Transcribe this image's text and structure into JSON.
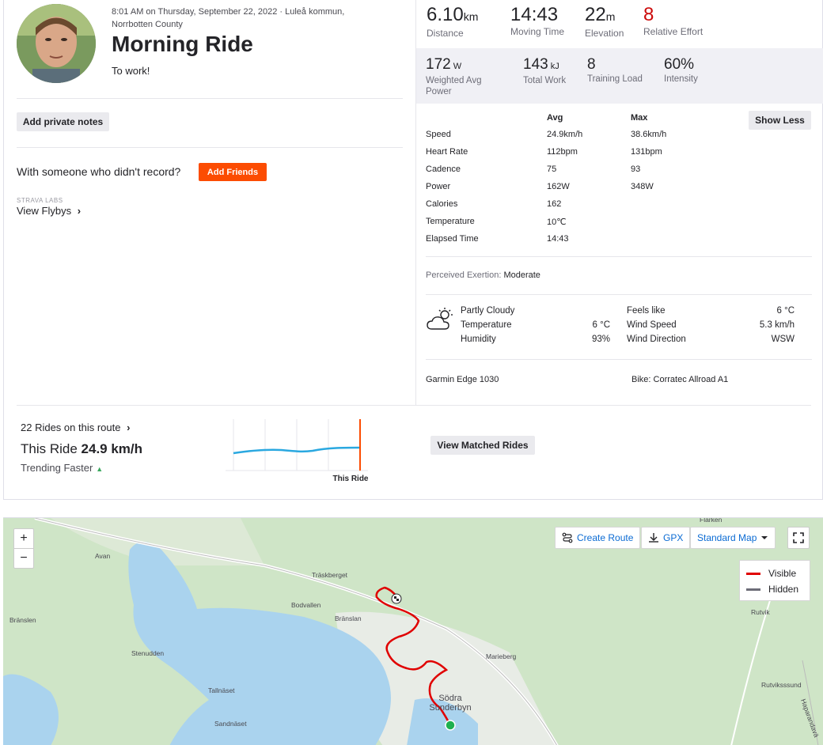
{
  "activity": {
    "datetime": "8:01 AM on Thursday, September 22, 2022 · Luleå kommun, Norrbotten County",
    "title": "Morning Ride",
    "description": "To work!",
    "add_private_notes": "Add private notes",
    "with_someone_text": "With someone who didn't record?",
    "add_friends": "Add Friends",
    "strava_labs": "STRAVA LABS",
    "view_flybys": "View Flybys",
    "chevron": "›"
  },
  "stats": {
    "distance": {
      "value": "6.10",
      "unit": "km",
      "label": "Distance"
    },
    "moving_time": {
      "value": "14:43",
      "label": "Moving Time"
    },
    "elevation": {
      "value": "22",
      "unit": "m",
      "label": "Elevation"
    },
    "relative_effort": {
      "value": "8",
      "label": "Relative Effort",
      "color": "#cc0a0a"
    },
    "weighted_power": {
      "value": "172",
      "unit": "W",
      "label": "Weighted Avg Power"
    },
    "total_work": {
      "value": "143",
      "unit": "kJ",
      "label": "Total Work"
    },
    "training_load": {
      "value": "8",
      "label": "Training Load"
    },
    "intensity": {
      "value": "60%",
      "label": "Intensity"
    }
  },
  "detail": {
    "show_less": "Show Less",
    "col_avg": "Avg",
    "col_max": "Max",
    "rows": [
      {
        "label": "Speed",
        "avg": "24.9km/h",
        "max": "38.6km/h"
      },
      {
        "label": "Heart Rate",
        "avg": "112bpm",
        "max": "131bpm"
      },
      {
        "label": "Cadence",
        "avg": "75",
        "max": "93"
      },
      {
        "label": "Power",
        "avg": "162W",
        "max": "348W"
      },
      {
        "label": "Calories",
        "avg": "162",
        "max": ""
      },
      {
        "label": "Temperature",
        "avg": "10℃",
        "max": ""
      },
      {
        "label": "Elapsed Time",
        "avg": "14:43",
        "max": ""
      }
    ],
    "perceived_label": "Perceived Exertion:",
    "perceived_value": "Moderate"
  },
  "weather": {
    "icon": "partly-cloudy-icon",
    "condition": "Partly Cloudy",
    "temperature_label": "Temperature",
    "temperature": "6 °C",
    "humidity_label": "Humidity",
    "humidity": "93%",
    "feels_like_label": "Feels like",
    "feels_like": "6 °C",
    "wind_speed_label": "Wind Speed",
    "wind_speed": "5.3 km/h",
    "wind_dir_label": "Wind Direction",
    "wind_dir": "WSW"
  },
  "gear": {
    "device": "Garmin Edge 1030",
    "bike": "Bike: Corratec Allroad A1"
  },
  "route_stats": {
    "rides_on_route": "22 Rides on this route",
    "this_ride_label": "This Ride",
    "this_ride_value": "24.9 km/h",
    "trending": "Trending Faster",
    "marker_label": "This Ride",
    "view_matched": "View Matched Rides",
    "accent": "#fc4c02",
    "line_color": "#2aa8e0"
  },
  "map": {
    "zoom_in": "+",
    "zoom_out": "−",
    "create_route": "Create Route",
    "gpx": "GPX",
    "map_style": "Standard Map",
    "legend_visible": "Visible",
    "legend_hidden": "Hidden",
    "route_color": "#e00000",
    "hidden_color": "#6d6d78",
    "labels": {
      "flarken": "Flarken",
      "avan": "Avan",
      "traskberget": "Träskberget",
      "bodvallen": "Bodvallen",
      "branslan_e": "Bränslan",
      "branslan_w": "Bränslen",
      "stenudden": "Stenudden",
      "tallnaset": "Tallnäset",
      "sandnaset": "Sandnäset",
      "marieberg": "Marieberg",
      "sodra_sunderbyn": "Södra Sunderbyn",
      "rutvik": "Rutvik",
      "rutviksssund": "Rutviksssund",
      "haparandavagen": "Haparandavä"
    }
  }
}
